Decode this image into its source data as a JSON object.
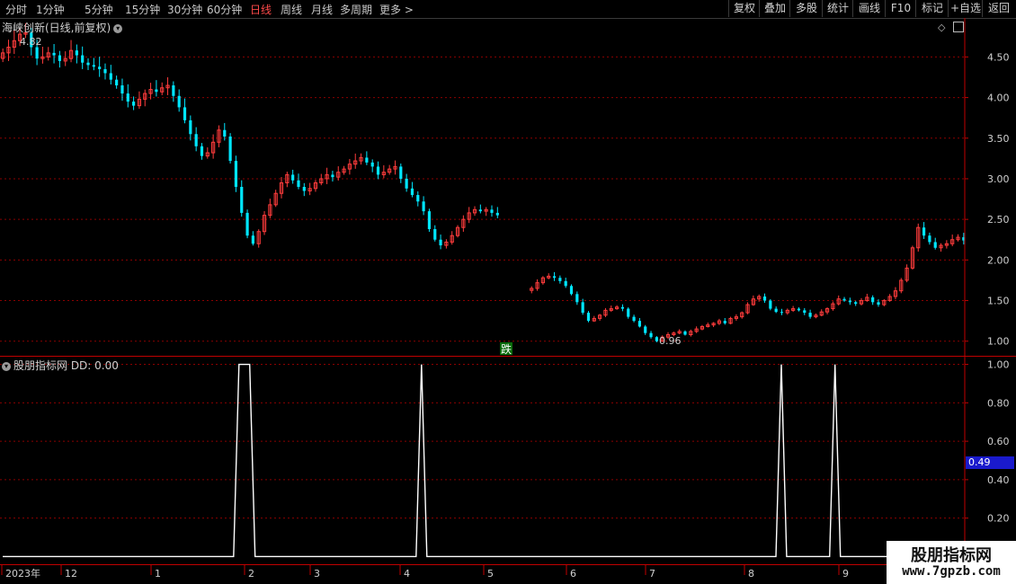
{
  "toolbar": {
    "periods": [
      "分时",
      "1分钟",
      "5分钟",
      "15分钟",
      "30分钟",
      "60分钟",
      "日线",
      "周线",
      "月线",
      "多周期",
      "更多"
    ],
    "active_period": "日线",
    "more_arrow": ">",
    "buttons": [
      "复权",
      "叠加",
      "多股",
      "统计",
      "画线",
      "F10",
      "标记",
      "+自选",
      "返回"
    ]
  },
  "main_panel": {
    "title": "海峡创新(日线,前复权)",
    "high_label": "4.82",
    "low_label": "0.96",
    "signal_label": "跌"
  },
  "indicator_panel": {
    "title": "股朋指标网 DD: 0.00",
    "current_value": "0.49"
  },
  "watermark": {
    "line1": "股朋指标网",
    "line2": "www.7gpzb.com"
  },
  "colors": {
    "up": "#ff3c3c",
    "down": "#00e6ff",
    "grid": "#8b0000",
    "line": "#ffffff",
    "axis": "#c00000"
  },
  "chart_data": [
    {
      "type": "candlestick",
      "title": "海峡创新(日线,前复权)",
      "y_ticks": [
        1.0,
        1.5,
        2.0,
        2.5,
        3.0,
        3.5,
        4.0,
        4.5
      ],
      "ylim": [
        0.82,
        4.98
      ],
      "x_tick_labels": [
        "2023年",
        "12",
        "1",
        "2",
        "3",
        "4",
        "5",
        "6",
        "7",
        "8",
        "9"
      ],
      "annotations": [
        {
          "text": "4.82",
          "value": 4.82
        },
        {
          "text": "0.96",
          "value": 0.96
        },
        {
          "text": "跌"
        }
      ],
      "closes": [
        4.55,
        4.62,
        4.7,
        4.78,
        4.8,
        4.62,
        4.48,
        4.5,
        4.55,
        4.52,
        4.45,
        4.48,
        4.58,
        4.52,
        4.43,
        4.4,
        4.38,
        4.35,
        4.3,
        4.22,
        4.15,
        4.05,
        3.95,
        3.9,
        3.98,
        4.05,
        4.1,
        4.07,
        4.12,
        4.15,
        4.02,
        3.88,
        3.72,
        3.55,
        3.4,
        3.28,
        3.32,
        3.45,
        3.6,
        3.52,
        3.22,
        2.9,
        2.58,
        2.3,
        2.2,
        2.35,
        2.55,
        2.68,
        2.82,
        2.95,
        3.05,
        2.98,
        2.9,
        2.85,
        2.88,
        2.95,
        3.0,
        3.05,
        3.02,
        3.08,
        3.12,
        3.18,
        3.22,
        3.26,
        3.2,
        3.15,
        3.05,
        3.08,
        3.12,
        3.15,
        3.0,
        2.88,
        2.8,
        2.72,
        2.6,
        2.38,
        2.25,
        2.18,
        2.22,
        2.3,
        2.4,
        2.5,
        2.58,
        2.62,
        2.6,
        2.62,
        2.58,
        2.55,
        null,
        null,
        null,
        null,
        null,
        1.65,
        1.72,
        1.78,
        1.8,
        1.78,
        1.74,
        1.68,
        1.58,
        1.48,
        1.35,
        1.25,
        1.28,
        1.32,
        1.38,
        1.4,
        1.42,
        1.4,
        1.3,
        1.25,
        1.18,
        1.1,
        1.05,
        1.0,
        1.05,
        1.08,
        1.1,
        1.12,
        1.08,
        1.12,
        1.15,
        1.18,
        1.2,
        1.22,
        1.25,
        1.22,
        1.28,
        1.3,
        1.35,
        1.45,
        1.52,
        1.55,
        1.5,
        1.4,
        1.36,
        1.35,
        1.38,
        1.4,
        1.38,
        1.35,
        1.3,
        1.32,
        1.36,
        1.4,
        1.46,
        1.52,
        1.5,
        1.48,
        1.46,
        1.5,
        1.54,
        1.48,
        1.45,
        1.5,
        1.55,
        1.62,
        1.75,
        1.9,
        2.15,
        2.4,
        2.3,
        2.22,
        2.15,
        2.18,
        2.2,
        2.25,
        2.28,
        2.24
      ]
    },
    {
      "type": "line",
      "title": "股朋指标网 DD",
      "series_name": "DD",
      "y_ticks": [
        0.2,
        0.4,
        0.6,
        0.8,
        1.0
      ],
      "ylim": [
        -0.04,
        1.04
      ],
      "current_value": 0.49,
      "values": [
        0,
        0,
        0,
        0,
        0,
        0,
        0,
        0,
        0,
        0,
        0,
        0,
        0,
        0,
        0,
        0,
        0,
        0,
        0,
        0,
        0,
        0,
        0,
        0,
        0,
        0,
        0,
        0,
        0,
        0,
        0,
        0,
        0,
        0,
        0,
        0,
        0,
        0,
        0,
        0,
        0,
        0,
        0,
        0,
        1,
        1,
        1,
        0,
        0,
        0,
        0,
        0,
        0,
        0,
        0,
        0,
        0,
        0,
        0,
        0,
        0,
        0,
        0,
        0,
        0,
        0,
        0,
        0,
        0,
        0,
        0,
        0,
        0,
        0,
        0,
        0,
        0,
        0,
        1,
        0,
        0,
        0,
        0,
        0,
        0,
        0,
        0,
        0,
        0,
        0,
        0,
        0,
        0,
        0,
        0,
        0,
        0,
        0,
        0,
        0,
        0,
        0,
        0,
        0,
        0,
        0,
        0,
        0,
        0,
        0,
        0,
        0,
        0,
        0,
        0,
        0,
        0,
        0,
        0,
        0,
        0,
        0,
        0,
        0,
        0,
        0,
        0,
        0,
        0,
        0,
        0,
        0,
        0,
        0,
        0,
        0,
        0,
        0,
        0,
        0,
        0,
        0,
        0,
        0,
        0,
        1,
        0,
        0,
        0,
        0,
        0,
        0,
        0,
        0,
        0,
        1,
        0,
        0,
        0,
        0,
        0,
        0,
        0,
        0,
        0,
        0,
        0,
        0,
        0,
        0,
        0,
        0,
        0,
        0,
        0,
        0,
        0,
        0,
        0,
        0
      ]
    }
  ]
}
